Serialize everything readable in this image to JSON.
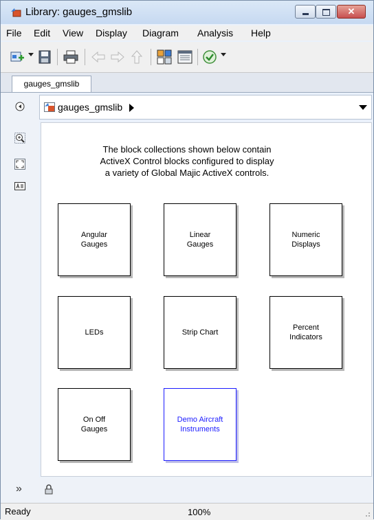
{
  "window": {
    "title": "Library: gauges_gmslib",
    "close_symbol": "✕"
  },
  "menu": [
    "File",
    "Edit",
    "View",
    "Display",
    "Diagram",
    "Analysis",
    "Help"
  ],
  "toolbar": {
    "buttons": [
      "new-library-icon",
      "save-icon",
      "print-icon",
      "back-icon",
      "forward-icon",
      "up-icon",
      "model-browser-icon",
      "model-explorer-icon",
      "check-icon"
    ]
  },
  "tab": {
    "label": "gauges_gmslib"
  },
  "address": {
    "path": "gauges_gmslib"
  },
  "palette": {
    "bottom_glyph": "»"
  },
  "canvas": {
    "intro": "The block collections shown below contain\nActiveX Control blocks configured to display\na variety of Global Majic ActiveX controls.",
    "blocks": [
      {
        "label": "Angular\nGauges"
      },
      {
        "label": "Linear\nGauges"
      },
      {
        "label": "Numeric\nDisplays"
      },
      {
        "label": "LEDs"
      },
      {
        "label": "Strip Chart"
      },
      {
        "label": "Percent\nIndicators"
      },
      {
        "label": "On Off\nGauges"
      },
      {
        "label": "Demo Aircraft\nInstruments"
      }
    ]
  },
  "status": {
    "state": "Ready",
    "zoom": "100%"
  },
  "colors": {
    "link_block": "#1a1aff",
    "title_bar": "#c6d9f1",
    "close_button": "#c75050"
  }
}
